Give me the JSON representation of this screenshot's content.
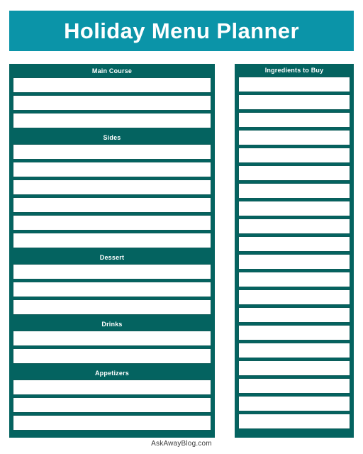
{
  "page": {
    "title": "Holiday Menu Planner",
    "footer_credit": "AskAwayBlog.com"
  },
  "colors": {
    "banner_teal": "#0b94a8",
    "panel_dark_teal": "#046360",
    "row_border": "#0d5c59",
    "row_fill": "#ffffff",
    "title_text": "#ffffff",
    "footer_text": "#3a3a3a"
  },
  "menu_panel": {
    "sections": [
      {
        "label": "Main Course",
        "row_count": 3
      },
      {
        "label": "Sides",
        "row_count": 6
      },
      {
        "label": "Dessert",
        "row_count": 3
      },
      {
        "label": "Drinks",
        "row_count": 2
      },
      {
        "label": "Appetizers",
        "row_count": 3
      }
    ]
  },
  "ingredients_panel": {
    "header": "Ingredients to Buy",
    "row_count": 20
  }
}
